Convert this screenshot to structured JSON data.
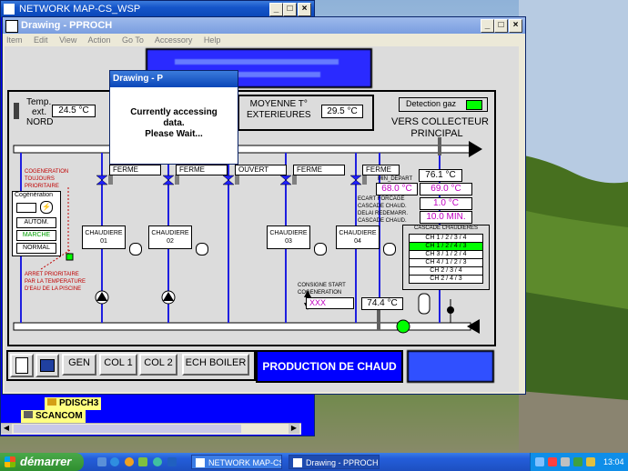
{
  "network_window": {
    "title": "NETWORK MAP-CS_WSP",
    "items": [
      "PDISCH3",
      "SCANCOM"
    ]
  },
  "drawing_window": {
    "title": "Drawing - PPROCH",
    "menu": [
      "Item",
      "Edit",
      "View",
      "Action",
      "Go To",
      "Accessory",
      "Help"
    ]
  },
  "dialog": {
    "title": "Drawing - P",
    "message_line1": "Currently accessing",
    "message_line2": "data.",
    "message_line3": "Please Wait..."
  },
  "plant": {
    "temp_ext_label_1": "Temp.",
    "temp_ext_label_2": "ext.",
    "temp_ext_label_3": "NORD",
    "temp_ext_value": "24.5 °C",
    "moyenne_label_1": "MOYENNE T°",
    "moyenne_label_2": "EXTERIEURES",
    "moyenne_value": "29.5 °C",
    "gas_label": "Detection gaz",
    "collector_label_1": "VERS COLLECTEUR",
    "collector_label_2": "PRINCIPAL",
    "valves": [
      "FERME",
      "FERME",
      "OUVERT",
      "FERME",
      "FERME"
    ],
    "cogen_note": [
      "COGENERATION",
      "TOUJOURS",
      "PRIORITAIRE"
    ],
    "cogen_panel": {
      "title": "Cogénération",
      "buttons": [
        "AUTOM.",
        "MARCHE",
        "NORMAL"
      ]
    },
    "boilers": [
      {
        "label": "CHAUDIERE",
        "num": "01"
      },
      {
        "label": "CHAUDIERE",
        "num": "02"
      },
      {
        "label": "CHAUDIERE",
        "num": "03"
      },
      {
        "label": "CHAUDIERE",
        "num": "04"
      }
    ],
    "min_depart_label": "MIN_DEPART",
    "temp_depart": "76.1 °C",
    "min_depart_value": "68.0 °C",
    "setpoint_value": "69.0 °C",
    "ecart_label_1": "ECART FORCAGE",
    "ecart_label_2": "CASCADE CHAUD.",
    "ecart_value": "1.0 °C",
    "delai_label_1": "DELAI REDEMARR.",
    "delai_label_2": "CASCADE CHAUD.",
    "delai_value": "10.0 MIN.",
    "cascade_title": "CASCADE CHAUDIERES",
    "cascade": [
      "CH 1 / 2 / 3 / 4",
      "CH 1 / 2 / 4 / 3",
      "CH 3 / 1 / 2 / 4",
      "CH 4 / 1 / 2 / 3",
      "CH 2 / 3 / 4",
      "CH 2 / 4 / 3"
    ],
    "arret_note": [
      "ARRET PRIORITAIRE",
      "PAR LA TEMPERATURE",
      "D'EAU DE LA PISCINE"
    ],
    "consigne_label_1": "CONSIGNE START",
    "consigne_label_2": "COGENERATION",
    "consigne_value": "XXX",
    "temp_retour": "74.4 °C"
  },
  "toolbar": {
    "gen": "GEN",
    "col1": "COL 1",
    "col2": "COL 2",
    "ech": "ECH BOILER",
    "production": "PRODUCTION DE CHAUD"
  },
  "taskbar": {
    "start": "démarrer",
    "tasks": [
      "NETWORK MAP-CS_...",
      "Drawing - PPROCH"
    ],
    "clock": "13:04"
  },
  "colors": {
    "blue_pipe": "#1f1fe0",
    "active_green": "#00ff00",
    "valve_blue": "#2020ff"
  }
}
